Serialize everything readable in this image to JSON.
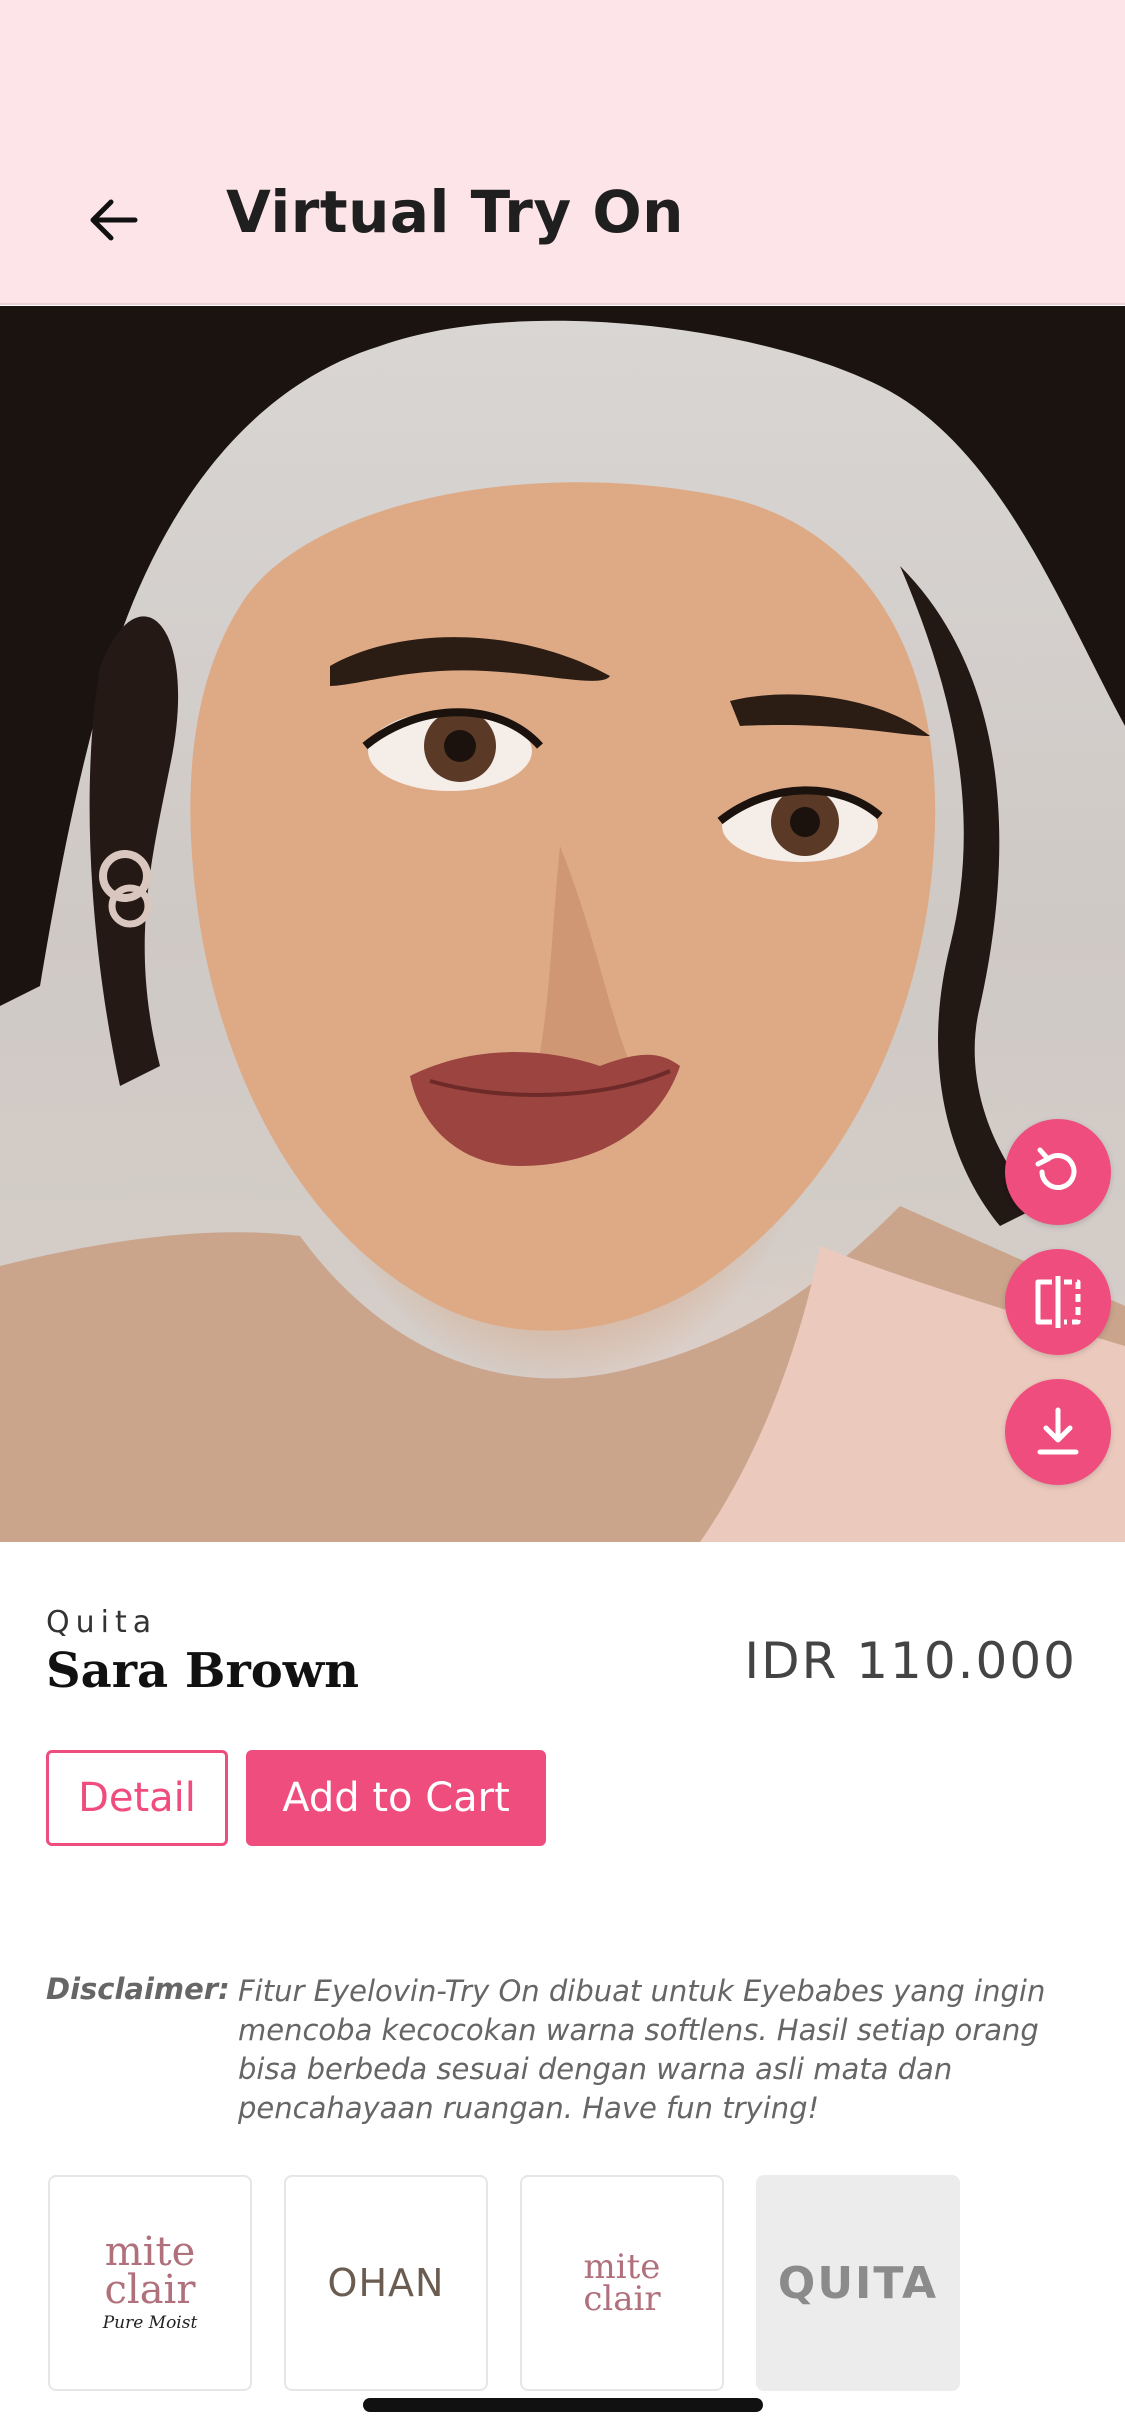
{
  "header": {
    "title": "Virtual Try On",
    "back_icon": "arrow-left-icon"
  },
  "camera": {
    "shutter_icon": "camera-icon",
    "actions": [
      {
        "name": "reset",
        "icon": "rotate-ccw-icon"
      },
      {
        "name": "compare",
        "icon": "split-compare-icon"
      },
      {
        "name": "download",
        "icon": "download-icon"
      }
    ],
    "accent_color": "#ef4d7e"
  },
  "product": {
    "brand": "Quita",
    "name": "Sara Brown",
    "price": "IDR 110.000"
  },
  "buttons": {
    "detail_label": "Detail",
    "cart_label": "Add to Cart"
  },
  "disclaimer": {
    "label": "Disclaimer:",
    "text": "Fitur Eyelovin-Try On dibuat untuk Eyebabes yang ingin mencoba kecocokan warna softlens. Hasil setiap orang bisa berbeda sesuai dengan warna asli mata dan pencahayaan ruangan. Have fun trying!"
  },
  "brands": [
    {
      "line1": "mite",
      "line2": "clair",
      "sub": "Pure Moist"
    },
    {
      "line1": "OHAN"
    },
    {
      "line1": "mite",
      "line2": "clair"
    },
    {
      "line1": "QUITA",
      "selected": true
    }
  ]
}
